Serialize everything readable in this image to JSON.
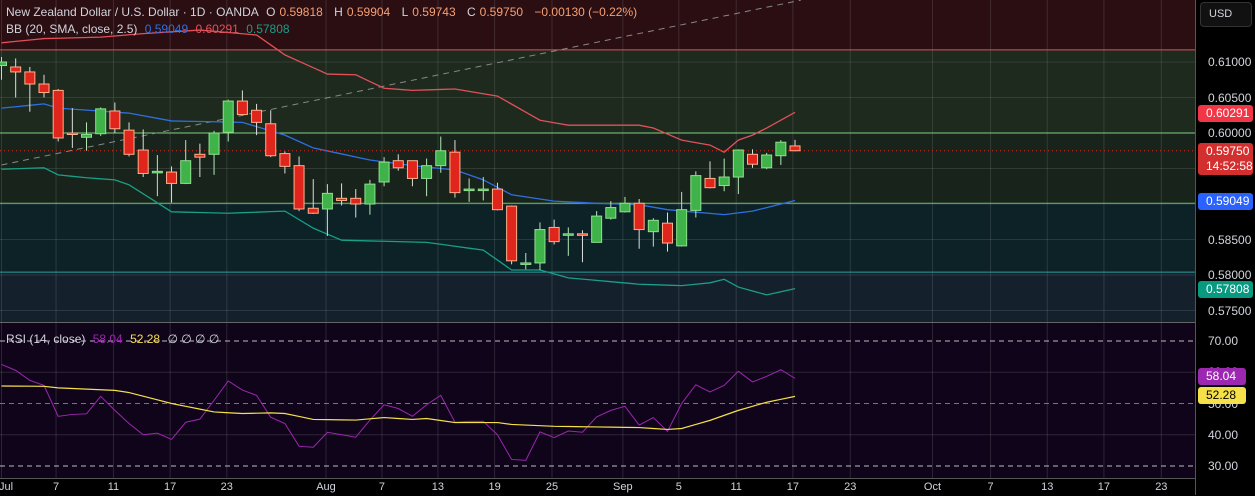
{
  "header": {
    "symbol": "New Zealand Dollar / U.S. Dollar · 1D · OANDA",
    "o_label": "O",
    "o": "0.59818",
    "h_label": "H",
    "h": "0.59904",
    "l_label": "L",
    "l": "0.59743",
    "c_label": "C",
    "c": "0.59750",
    "change": "−0.00130 (−0.22%)"
  },
  "bb_legend": {
    "label": "BB (20, SMA, close, 2.5)",
    "basis": "0.59049",
    "upper": "0.60291",
    "lower": "0.57808"
  },
  "rsi_legend": {
    "label": "RSI (14, close)",
    "rsi": "58.04",
    "ma": "52.28",
    "extra": "∅ ∅ ∅ ∅"
  },
  "currency_button": "USD",
  "price_axis": [
    {
      "v": 0.61,
      "t": "0.61000"
    },
    {
      "v": 0.605,
      "t": "0.60500"
    },
    {
      "v": 0.6,
      "t": "0.60000"
    },
    {
      "v": 0.585,
      "t": "0.58500"
    },
    {
      "v": 0.58,
      "t": "0.58000"
    },
    {
      "v": 0.575,
      "t": "0.57500"
    }
  ],
  "rsi_axis": [
    {
      "v": 70,
      "t": "70.00"
    },
    {
      "v": 60,
      "t": "60.00"
    },
    {
      "v": 50,
      "t": "50.00"
    },
    {
      "v": 40,
      "t": "40.00"
    },
    {
      "v": 30,
      "t": "30.00"
    }
  ],
  "badges": {
    "upper": "0.60291",
    "last": "0.59750",
    "countdown": "14:52:58",
    "basis": "0.59049",
    "lower": "0.57808",
    "rsi": "58.04",
    "rsi_ma": "52.28"
  },
  "time_axis": [
    {
      "i": 0,
      "t": "Jul"
    },
    {
      "i": 3.85,
      "t": "7"
    },
    {
      "i": 7.9,
      "t": "11"
    },
    {
      "i": 11.9,
      "t": "17"
    },
    {
      "i": 15.9,
      "t": "23"
    },
    {
      "i": 22.9,
      "t": "Aug"
    },
    {
      "i": 26.85,
      "t": "7"
    },
    {
      "i": 30.8,
      "t": "13"
    },
    {
      "i": 34.8,
      "t": "19"
    },
    {
      "i": 38.85,
      "t": "25"
    },
    {
      "i": 43.85,
      "t": "Sep"
    },
    {
      "i": 47.8,
      "t": "5"
    },
    {
      "i": 51.85,
      "t": "11"
    },
    {
      "i": 55.85,
      "t": "17"
    },
    {
      "i": 59.9,
      "t": "23"
    },
    {
      "i": 65.7,
      "t": "Oct"
    },
    {
      "i": 69.8,
      "t": "7"
    },
    {
      "i": 73.8,
      "t": "13"
    },
    {
      "i": 77.8,
      "t": "17"
    },
    {
      "i": 81.85,
      "t": "23"
    }
  ],
  "colors": {
    "up": "#3fb24a",
    "down": "#e0261c",
    "upper": "#e2505a",
    "basis": "#2f6fe0",
    "lower": "#1a9e86",
    "rsi": "#9c27b0",
    "rsi_ma": "#f5e04a"
  },
  "chart_data": {
    "type": "candlestick",
    "candles": [
      [
        0.6095,
        0.6107,
        0.6075,
        0.61
      ],
      [
        0.6093,
        0.6105,
        0.605,
        0.6086
      ],
      [
        0.6086,
        0.6093,
        0.603,
        0.6069
      ],
      [
        0.6069,
        0.6082,
        0.605,
        0.6057
      ],
      [
        0.606,
        0.6062,
        0.5988,
        0.5993
      ],
      [
        0.6,
        0.6035,
        0.5979,
        0.5999
      ],
      [
        0.5994,
        0.6015,
        0.5975,
        0.5998
      ],
      [
        0.5999,
        0.6036,
        0.5996,
        0.6034
      ],
      [
        0.6031,
        0.6043,
        0.6,
        0.6006
      ],
      [
        0.6004,
        0.6015,
        0.5967,
        0.597
      ],
      [
        0.5976,
        0.6005,
        0.5938,
        0.5943
      ],
      [
        0.5946,
        0.5969,
        0.5911,
        0.5946
      ],
      [
        0.5945,
        0.5953,
        0.5902,
        0.5929
      ],
      [
        0.5929,
        0.599,
        0.5928,
        0.5961
      ],
      [
        0.597,
        0.5985,
        0.5938,
        0.5966
      ],
      [
        0.597,
        0.6003,
        0.5941,
        0.6
      ],
      [
        0.6001,
        0.6047,
        0.5988,
        0.6045
      ],
      [
        0.6045,
        0.606,
        0.6025,
        0.6026
      ],
      [
        0.6032,
        0.6041,
        0.5997,
        0.6015
      ],
      [
        0.6013,
        0.6032,
        0.5966,
        0.5968
      ],
      [
        0.5971,
        0.5974,
        0.5943,
        0.5953
      ],
      [
        0.5954,
        0.5967,
        0.589,
        0.5893
      ],
      [
        0.5894,
        0.5935,
        0.5886,
        0.5887
      ],
      [
        0.5893,
        0.5928,
        0.5855,
        0.5915
      ],
      [
        0.5908,
        0.5929,
        0.5898,
        0.5905
      ],
      [
        0.5908,
        0.5921,
        0.5881,
        0.59
      ],
      [
        0.59,
        0.5934,
        0.5885,
        0.5928
      ],
      [
        0.5931,
        0.5966,
        0.5925,
        0.5959
      ],
      [
        0.5961,
        0.597,
        0.5947,
        0.5951
      ],
      [
        0.5961,
        0.5961,
        0.5925,
        0.5936
      ],
      [
        0.5936,
        0.5964,
        0.5911,
        0.5954
      ],
      [
        0.5954,
        0.5995,
        0.5944,
        0.5975
      ],
      [
        0.5973,
        0.599,
        0.5909,
        0.5916
      ],
      [
        0.5921,
        0.5936,
        0.5903,
        0.5921
      ],
      [
        0.5921,
        0.5938,
        0.5905,
        0.5921
      ],
      [
        0.5921,
        0.593,
        0.5891,
        0.5892
      ],
      [
        0.5897,
        0.5898,
        0.5815,
        0.582
      ],
      [
        0.5817,
        0.5831,
        0.5808,
        0.5817
      ],
      [
        0.5817,
        0.5874,
        0.5807,
        0.5864
      ],
      [
        0.5867,
        0.5878,
        0.5843,
        0.5847
      ],
      [
        0.5858,
        0.5867,
        0.5827,
        0.5858
      ],
      [
        0.5858,
        0.5863,
        0.5818,
        0.5856
      ],
      [
        0.5846,
        0.589,
        0.5846,
        0.5883
      ],
      [
        0.588,
        0.5904,
        0.5878,
        0.5895
      ],
      [
        0.5889,
        0.591,
        0.5888,
        0.5901
      ],
      [
        0.5901,
        0.5907,
        0.5837,
        0.5864
      ],
      [
        0.5861,
        0.588,
        0.584,
        0.5877
      ],
      [
        0.5873,
        0.5888,
        0.5833,
        0.5845
      ],
      [
        0.5841,
        0.5917,
        0.584,
        0.5892
      ],
      [
        0.5891,
        0.5946,
        0.5881,
        0.594
      ],
      [
        0.5936,
        0.596,
        0.5922,
        0.5923
      ],
      [
        0.5926,
        0.5964,
        0.5918,
        0.5938
      ],
      [
        0.5938,
        0.5977,
        0.5914,
        0.5976
      ],
      [
        0.597,
        0.5977,
        0.5951,
        0.5956
      ],
      [
        0.5951,
        0.5972,
        0.5949,
        0.5969
      ],
      [
        0.5968,
        0.599,
        0.5955,
        0.5987
      ],
      [
        0.59818,
        0.59904,
        0.59743,
        0.5975
      ]
    ],
    "bb_upper": [
      [
        0,
        0.6127
      ],
      [
        3,
        0.6133
      ],
      [
        7,
        0.6135
      ],
      [
        10,
        0.614
      ],
      [
        14,
        0.6145
      ],
      [
        18,
        0.6138
      ],
      [
        20,
        0.611
      ],
      [
        23,
        0.6083
      ],
      [
        25,
        0.6082
      ],
      [
        27,
        0.6063
      ],
      [
        29,
        0.606
      ],
      [
        32,
        0.6062
      ],
      [
        35,
        0.6052
      ],
      [
        38,
        0.6018
      ],
      [
        40,
        0.6011
      ],
      [
        45,
        0.6011
      ],
      [
        46,
        0.6007
      ],
      [
        48,
        0.599
      ],
      [
        50,
        0.5983
      ],
      [
        51,
        0.5973
      ],
      [
        52,
        0.599
      ],
      [
        53,
        0.5997
      ],
      [
        54,
        0.6007
      ],
      [
        55,
        0.6018
      ],
      [
        56,
        0.60291
      ]
    ],
    "bb_basis": [
      [
        0,
        0.6035
      ],
      [
        3,
        0.6041
      ],
      [
        4,
        0.6035
      ],
      [
        9,
        0.6028
      ],
      [
        12,
        0.6017
      ],
      [
        17,
        0.6015
      ],
      [
        20,
        0.5997
      ],
      [
        22,
        0.5979
      ],
      [
        26,
        0.5962
      ],
      [
        29,
        0.5954
      ],
      [
        32,
        0.5948
      ],
      [
        34,
        0.5934
      ],
      [
        36,
        0.5913
      ],
      [
        39,
        0.5904
      ],
      [
        42,
        0.5901
      ],
      [
        45,
        0.5899
      ],
      [
        47,
        0.5892
      ],
      [
        51,
        0.5885
      ],
      [
        53,
        0.589
      ],
      [
        56,
        0.59049
      ]
    ],
    "bb_lower": [
      [
        0,
        0.5949
      ],
      [
        3,
        0.5951
      ],
      [
        4,
        0.5941
      ],
      [
        6,
        0.5937
      ],
      [
        8,
        0.5934
      ],
      [
        9,
        0.5927
      ],
      [
        12,
        0.5889
      ],
      [
        16,
        0.5887
      ],
      [
        20,
        0.589
      ],
      [
        22,
        0.5866
      ],
      [
        24,
        0.5849
      ],
      [
        30,
        0.5846
      ],
      [
        34,
        0.5835
      ],
      [
        36,
        0.5807
      ],
      [
        38,
        0.5807
      ],
      [
        40,
        0.5796
      ],
      [
        45,
        0.5787
      ],
      [
        48,
        0.5785
      ],
      [
        50,
        0.5789
      ],
      [
        51,
        0.5794
      ],
      [
        52,
        0.5783
      ],
      [
        54,
        0.5772
      ],
      [
        56,
        0.57808
      ]
    ],
    "levels": [
      {
        "p": 0.6117,
        "color": "#e2505a"
      },
      {
        "p": 0.6,
        "color": "#7fd07f"
      },
      {
        "p": 0.5901,
        "color": "#5fc45f"
      },
      {
        "p": 0.5804,
        "color": "#2aa0a0"
      }
    ],
    "trendline": [
      [
        0,
        0.5955
      ],
      [
        56.4,
        0.6187
      ]
    ],
    "rsi": [
      62.5,
      60.6,
      57.4,
      55.8,
      45.9,
      46.5,
      46.7,
      52.3,
      47.8,
      43.6,
      40,
      40.5,
      38.5,
      44,
      45,
      51,
      57.2,
      54.3,
      52.6,
      45.6,
      43.6,
      36.3,
      36,
      40.8,
      40,
      39.2,
      44.7,
      49.6,
      48.4,
      45.9,
      49.6,
      52.6,
      44,
      44.3,
      44.3,
      40,
      32.1,
      31.8,
      40.9,
      39.1,
      41.2,
      40.8,
      45.7,
      47.8,
      49.1,
      43.1,
      45.5,
      41.1,
      50,
      56,
      53.7,
      55.8,
      60.3,
      56.9,
      58.7,
      60.8,
      58.04
    ],
    "rsi_ma": [
      [
        0,
        55.6
      ],
      [
        3,
        55.5
      ],
      [
        4,
        55
      ],
      [
        8,
        54.2
      ],
      [
        9,
        53.5
      ],
      [
        12,
        50
      ],
      [
        15,
        47.3
      ],
      [
        17,
        46.8
      ],
      [
        19,
        47
      ],
      [
        20,
        46.8
      ],
      [
        22,
        44.9
      ],
      [
        25,
        44.7
      ],
      [
        27,
        45.5
      ],
      [
        29,
        44.9
      ],
      [
        30,
        45.2
      ],
      [
        32,
        43.9
      ],
      [
        35,
        43.9
      ],
      [
        36,
        43.3
      ],
      [
        39,
        42.7
      ],
      [
        45,
        42.3
      ],
      [
        47,
        41.7
      ],
      [
        48,
        42
      ],
      [
        50,
        44.6
      ],
      [
        52,
        47.8
      ],
      [
        54,
        50.4
      ],
      [
        56,
        52.28
      ]
    ],
    "price_range": [
      0.5725,
      0.6187
    ],
    "rsi_range": [
      30,
      70
    ]
  }
}
